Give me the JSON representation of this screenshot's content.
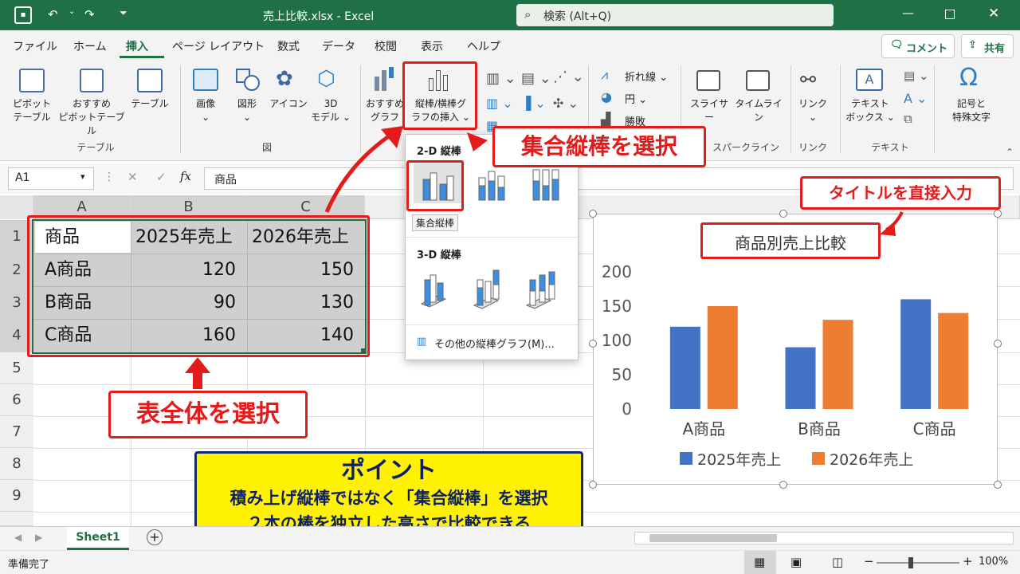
{
  "window": {
    "title": "売上比較.xlsx - Excel",
    "search_placeholder": "検索 (Alt+Q)",
    "comment_button": "コメント",
    "share_button": "共有"
  },
  "menu_tabs": [
    "ファイル",
    "ホーム",
    "挿入",
    "ページ レイアウト",
    "数式",
    "データ",
    "校閲",
    "表示",
    "ヘルプ"
  ],
  "active_tab": "挿入",
  "ribbon": {
    "table_group": {
      "name": "テーブル",
      "items": [
        {
          "line1": "ピボット",
          "line2": "テーブル"
        },
        {
          "line1": "おすすめ",
          "line2": "ピボットテーブル"
        },
        {
          "line1": "テーブル",
          "line2": ""
        }
      ]
    },
    "figure_group": {
      "name": "図",
      "items": [
        {
          "line1": "画像",
          "line2": ""
        },
        {
          "line1": "図形",
          "line2": ""
        },
        {
          "line1": "アイコン",
          "line2": ""
        },
        {
          "line1": "3D",
          "line2": "モデル"
        }
      ]
    },
    "charts_group": {
      "recommended": {
        "line1": "おすすめ",
        "line2": "グラフ"
      },
      "column_bar": {
        "line1": "縦棒/横棒グ",
        "line2": "ラフの挿入"
      }
    },
    "sparkline_group": {
      "name": "スパークライン",
      "items": [
        "折れ線",
        "円",
        "勝敗"
      ]
    },
    "filter_group": {
      "items": [
        "スライサー",
        "タイムライン"
      ]
    },
    "link_group": {
      "name": "リンク",
      "items": [
        "リンク"
      ]
    },
    "text_group": {
      "name": "テキスト",
      "items": [
        {
          "line1": "テキスト",
          "line2": "ボックス"
        }
      ]
    },
    "symbols_group": {
      "items": [
        {
          "line1": "記号と",
          "line2": "特殊文字"
        }
      ]
    }
  },
  "formula_bar": {
    "name_box": "A1",
    "fx_label": "fx",
    "content": "商品"
  },
  "grid": {
    "columns": [
      "A",
      "B",
      "C"
    ],
    "rows": [
      "1",
      "2",
      "3",
      "4",
      "5",
      "6",
      "7",
      "8",
      "9"
    ],
    "table": [
      [
        "商品",
        "2025年売上",
        "2026年売上"
      ],
      [
        "A商品",
        "120",
        "150"
      ],
      [
        "B商品",
        "90",
        "130"
      ],
      [
        "C商品",
        "160",
        "140"
      ]
    ]
  },
  "dropdown": {
    "section_2d": "2-D 縦棒",
    "selected_label": "集合縦棒",
    "section_3d": "3-D 縦棒",
    "more_link": "その他の縦棒グラフ(M)..."
  },
  "chart_data": {
    "type": "bar",
    "title": "商品別売上比較",
    "categories": [
      "A商品",
      "B商品",
      "C商品"
    ],
    "series": [
      {
        "name": "2025年売上",
        "values": [
          120,
          90,
          160
        ],
        "color": "#4472c4"
      },
      {
        "name": "2026年売上",
        "values": [
          150,
          130,
          140
        ],
        "color": "#ed7d31"
      }
    ],
    "ylim": [
      0,
      200
    ],
    "yticks": [
      "0",
      "50",
      "100",
      "150",
      "200"
    ],
    "legend": "bottom",
    "grid": false
  },
  "callouts": {
    "select_clustered": "集合縦棒を選択",
    "select_table": "表全体を選択",
    "edit_title": "タイトルを直接入力"
  },
  "point_box": {
    "heading": "ポイント",
    "line1": "積み上げ縦棒ではなく「集合縦棒」を選択",
    "line2": "２本の棒を独立した高さで比較できる"
  },
  "sheet": {
    "tab": "Sheet1",
    "status": "準備完了",
    "zoom": "100%"
  },
  "colors": {
    "excel_green": "#1f7145",
    "callout_red": "#e21b1b",
    "point_yellow": "#fff200",
    "point_navy": "#102a6b"
  }
}
